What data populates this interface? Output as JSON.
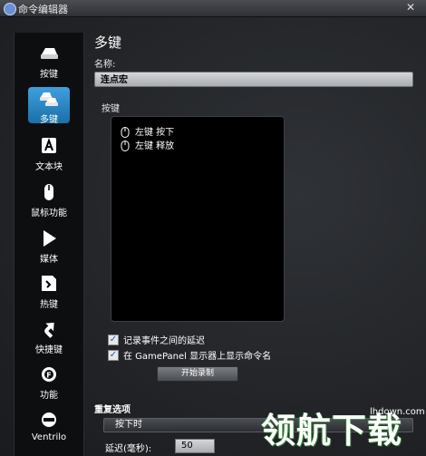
{
  "window": {
    "title": "命令编辑器",
    "close_glyph": "✕"
  },
  "sidebar": {
    "items": [
      {
        "label": "按键",
        "icon": "key-icon"
      },
      {
        "label": "多键",
        "icon": "multi-key-icon",
        "active": true
      },
      {
        "label": "文本块",
        "icon": "text-block-icon"
      },
      {
        "label": "鼠标功能",
        "icon": "mouse-icon"
      },
      {
        "label": "媒体",
        "icon": "media-play-icon"
      },
      {
        "label": "热键",
        "icon": "hotkey-icon"
      },
      {
        "label": "快捷键",
        "icon": "shortcut-arrow-icon"
      },
      {
        "label": "功能",
        "icon": "function-gear-icon"
      },
      {
        "label": "Ventrilo",
        "icon": "headset-icon"
      }
    ]
  },
  "main": {
    "heading": "多键",
    "name_label": "名称:",
    "name_value": "连点宏",
    "keys_label": "按键",
    "key_events": [
      {
        "text": "左键 按下",
        "icon": "mouse-icon"
      },
      {
        "text": "左键 释放",
        "icon": "mouse-icon"
      }
    ],
    "options": [
      {
        "label": "记录事件之间的延迟",
        "checked": true
      },
      {
        "label": "在 GamePanel 显示器上显示命令名",
        "checked": true
      }
    ],
    "record_button": "开始录制",
    "repeat_label": "重复选项",
    "repeat_value": "按下时",
    "delay_label": "延迟(毫秒):",
    "delay_value": "50"
  },
  "watermark": {
    "text": "领航下载",
    "url": "lhdown.com"
  },
  "colors": {
    "accent": "#2a8cd0",
    "background": "#232528",
    "sidebar": "#0d0e10"
  }
}
